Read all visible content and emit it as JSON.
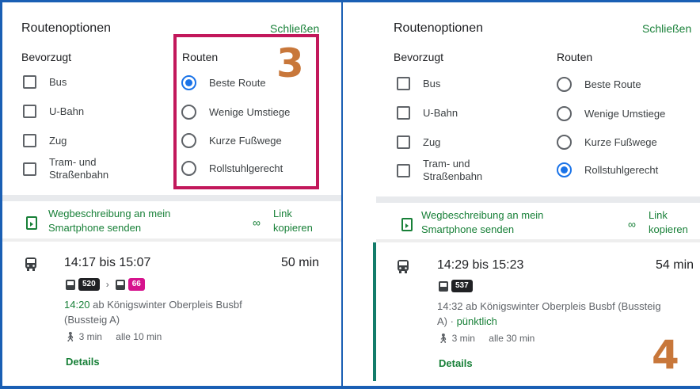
{
  "left": {
    "title": "Routenoptionen",
    "close": "Schließen",
    "preferred_heading": "Bevorzugt",
    "routes_heading": "Routen",
    "preferred": [
      {
        "label": "Bus"
      },
      {
        "label": "U-Bahn"
      },
      {
        "label": "Zug"
      },
      {
        "label_line1": "Tram- und",
        "label_line2": "Straßenbahn"
      }
    ],
    "routes": [
      {
        "label": "Beste Route",
        "checked": true
      },
      {
        "label": "Wenige Umstiege",
        "checked": false
      },
      {
        "label": "Kurze Fußwege",
        "checked": false
      },
      {
        "label": "Rollstuhlgerecht",
        "checked": false
      }
    ],
    "share_line1": "Wegbeschreibung an mein",
    "share_line2": "Smartphone senden",
    "link_line1": "Link",
    "link_line2": "kopieren",
    "trip": {
      "time": "14:17 bis 15:07",
      "duration": "50 min",
      "line1": "520",
      "line2": "66",
      "dep_time": "14:20",
      "dep_text": " ab Königswinter Oberpleis Busbf",
      "dep_text2": "(Bussteig A)",
      "walk": "3 min",
      "freq": "alle 10 min",
      "details": "Details"
    },
    "annotation": "3"
  },
  "right": {
    "title": "Routenoptionen",
    "close": "Schließen",
    "preferred_heading": "Bevorzugt",
    "routes_heading": "Routen",
    "preferred": [
      {
        "label": "Bus"
      },
      {
        "label": "U-Bahn"
      },
      {
        "label": "Zug"
      },
      {
        "label_line1": "Tram- und",
        "label_line2": "Straßenbahn"
      }
    ],
    "routes": [
      {
        "label": "Beste Route",
        "checked": false
      },
      {
        "label": "Wenige Umstiege",
        "checked": false
      },
      {
        "label": "Kurze Fußwege",
        "checked": false
      },
      {
        "label": "Rollstuhlgerecht",
        "checked": true
      }
    ],
    "share_line1": "Wegbeschreibung an mein",
    "share_line2": "Smartphone senden",
    "link_line1": "Link",
    "link_line2": "kopieren",
    "trip": {
      "time": "14:29 bis 15:23",
      "duration": "54 min",
      "line1": "537",
      "dep_text": "14:32 ab Königswinter Oberpleis Busbf (Bussteig",
      "dep_text2": "A) · ",
      "punctual": "pünktlich",
      "walk": "3 min",
      "freq": "alle 30 min",
      "details": "Details"
    },
    "annotation": "4"
  },
  "colors": {
    "accent_green": "#188038",
    "radio_blue": "#1a73e8",
    "highlight": "#c2185b",
    "annotation": "#c8773a",
    "frame_blue": "#1a5fb4"
  }
}
